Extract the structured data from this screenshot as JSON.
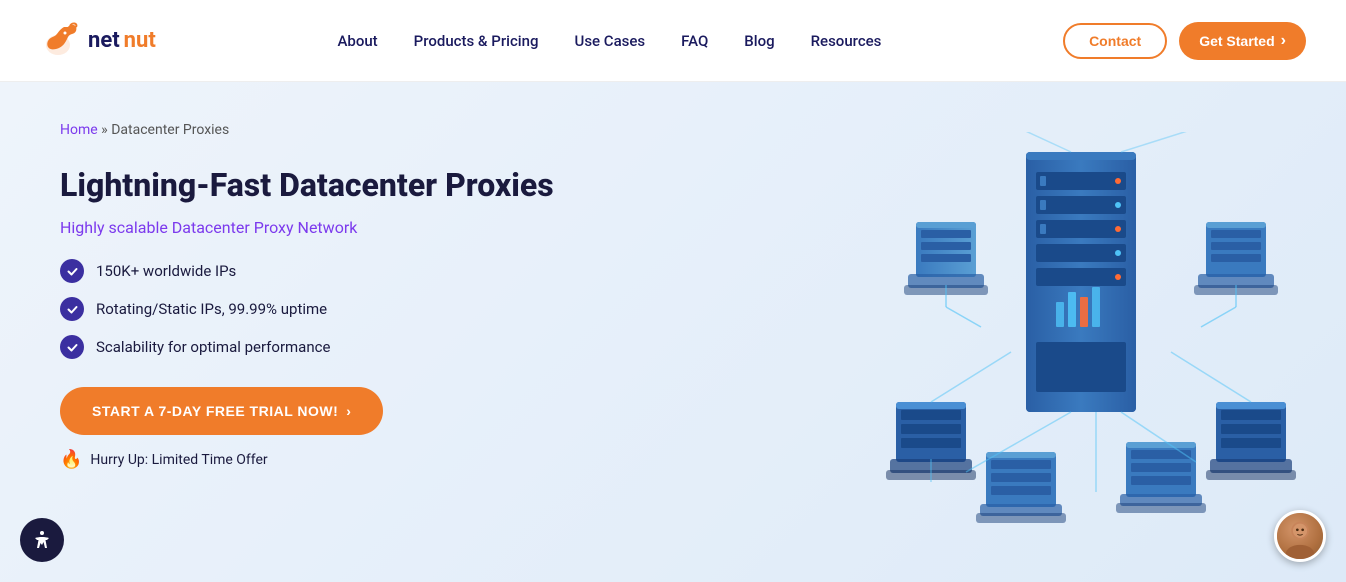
{
  "header": {
    "logo": {
      "text_net": "net",
      "text_nut": "nut"
    },
    "nav": {
      "items": [
        {
          "label": "About",
          "id": "about"
        },
        {
          "label": "Products & Pricing",
          "id": "products"
        },
        {
          "label": "Use Cases",
          "id": "use-cases"
        },
        {
          "label": "FAQ",
          "id": "faq"
        },
        {
          "label": "Blog",
          "id": "blog"
        },
        {
          "label": "Resources",
          "id": "resources"
        }
      ]
    },
    "actions": {
      "contact_label": "Contact",
      "get_started_label": "Get Started",
      "arrow": "›"
    }
  },
  "hero": {
    "breadcrumb": {
      "home": "Home",
      "separator": "»",
      "current": "Datacenter Proxies"
    },
    "title": "Lightning-Fast Datacenter Proxies",
    "subtitle": "Highly scalable Datacenter Proxy Network",
    "features": [
      {
        "text": "150K+ worldwide IPs"
      },
      {
        "text": "Rotating/Static IPs, 99.99% uptime"
      },
      {
        "text": "Scalability for optimal performance"
      }
    ],
    "cta_button": "START A 7-DAY FREE TRIAL NOW!",
    "cta_arrow": "›",
    "hurry_text": "Hurry Up: Limited Time Offer"
  }
}
